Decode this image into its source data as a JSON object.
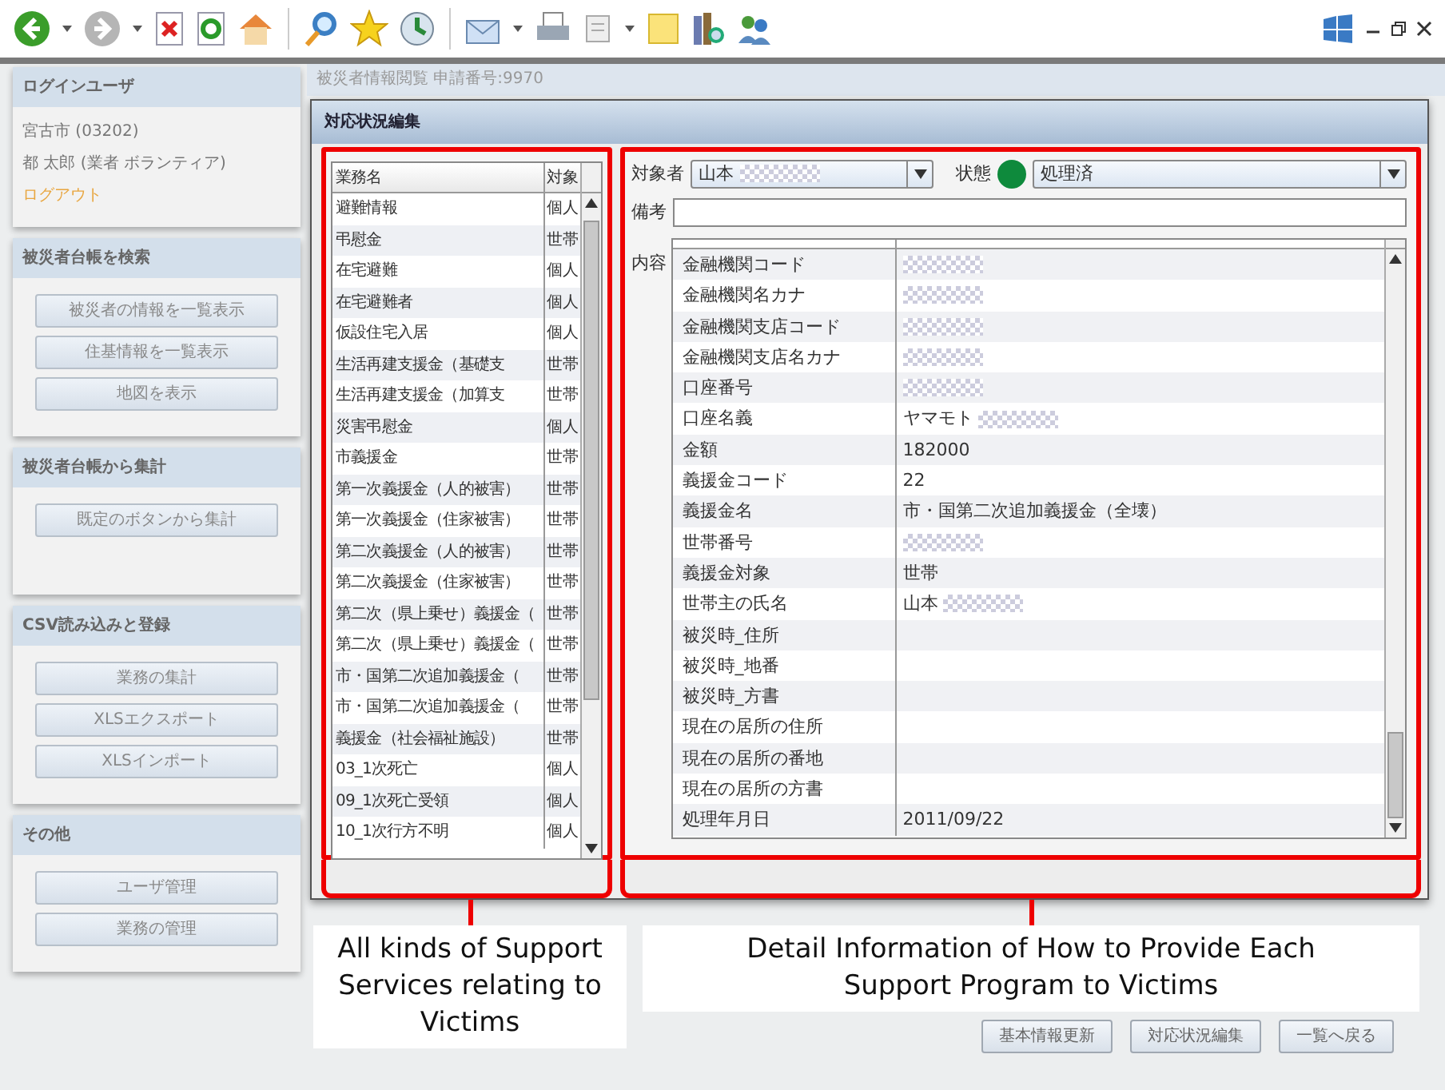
{
  "page_title": "被災者情報閲覧 申請番号:9970",
  "sidebar": {
    "sections": [
      {
        "title": "ログインユーザ",
        "lines": [
          "宮古市 (03202)",
          "都 太郎 (業者 ボランティア)"
        ],
        "link": "ログアウト"
      },
      {
        "title": "被災者台帳を検索",
        "buttons": [
          "被災者の情報を一覧表示",
          "住基情報を一覧表示",
          "地図を表示"
        ]
      },
      {
        "title": "被災者台帳から集計",
        "buttons": [
          "既定のボタンから集計"
        ]
      },
      {
        "title": "CSV読み込みと登録",
        "buttons": [
          "業務の集計",
          "XLSエクスポート",
          "XLSインポート"
        ]
      },
      {
        "title": "その他",
        "buttons": [
          "ユーザ管理",
          "業務の管理"
        ]
      }
    ]
  },
  "dialog": {
    "title": "対応状況編集",
    "services": {
      "columns": [
        "業務名",
        "対象"
      ],
      "rows": [
        [
          "避難情報",
          "個人"
        ],
        [
          "弔慰金",
          "世帯"
        ],
        [
          "在宅避難",
          "個人"
        ],
        [
          "在宅避難者",
          "個人"
        ],
        [
          "仮設住宅入居",
          "個人"
        ],
        [
          "生活再建支援金（基礎支",
          "世帯"
        ],
        [
          "生活再建支援金（加算支",
          "世帯"
        ],
        [
          "災害弔慰金",
          "個人"
        ],
        [
          "市義援金",
          "世帯"
        ],
        [
          "第一次義援金（人的被害）",
          "世帯"
        ],
        [
          "第一次義援金（住家被害）",
          "世帯"
        ],
        [
          "第二次義援金（人的被害）",
          "世帯"
        ],
        [
          "第二次義援金（住家被害）",
          "世帯"
        ],
        [
          "第二次（県上乗せ）義援金（",
          "世帯"
        ],
        [
          "第二次（県上乗せ）義援金（",
          "世帯"
        ],
        [
          "市・国第二次追加義援金（",
          "世帯"
        ],
        [
          "市・国第二次追加義援金（",
          "世帯"
        ],
        [
          "義援金（社会福祉施設）",
          "世帯"
        ],
        [
          "03_1次死亡",
          "個人"
        ],
        [
          "09_1次死亡受領",
          "個人"
        ],
        [
          "10_1次行方不明",
          "個人"
        ]
      ]
    },
    "detail": {
      "target": {
        "label": "対象者",
        "value": "山本",
        "redacted": true
      },
      "status": {
        "label": "状態",
        "color": "#0e8a3c",
        "value": "処理済"
      },
      "remarks": {
        "label": "備考"
      },
      "content": {
        "label": "内容",
        "rows": [
          {
            "label": "金融機関コード",
            "redacted": true
          },
          {
            "label": "金融機関名カナ",
            "redacted": true
          },
          {
            "label": "金融機関支店コード",
            "redacted": true
          },
          {
            "label": "金融機関支店名カナ",
            "redacted": true
          },
          {
            "label": "口座番号",
            "redacted": true
          },
          {
            "label": "口座名義",
            "value": "ヤマモト",
            "redacted": true
          },
          {
            "label": "金額",
            "value": "182000"
          },
          {
            "label": "義援金コード",
            "value": "22"
          },
          {
            "label": "義援金名",
            "value": "市・国第二次追加義援金（全壊）"
          },
          {
            "label": "世帯番号",
            "redacted": true
          },
          {
            "label": "義援金対象",
            "value": "世帯"
          },
          {
            "label": "世帯主の氏名",
            "value": "山本",
            "redacted": true
          },
          {
            "label": "被災時_住所"
          },
          {
            "label": "被災時_地番"
          },
          {
            "label": "被災時_方書"
          },
          {
            "label": "現在の居所の住所"
          },
          {
            "label": "現在の居所の番地"
          },
          {
            "label": "現在の居所の方書"
          },
          {
            "label": "処理年月日",
            "value": "2011/09/22"
          }
        ]
      }
    }
  },
  "annotations": [
    "All kinds of Support Services relating to Victims",
    "Detail Information of How to Provide Each Support Program to Victims"
  ],
  "footer_buttons": [
    "基本情報更新",
    "対応状況編集",
    "一覧へ戻る"
  ]
}
